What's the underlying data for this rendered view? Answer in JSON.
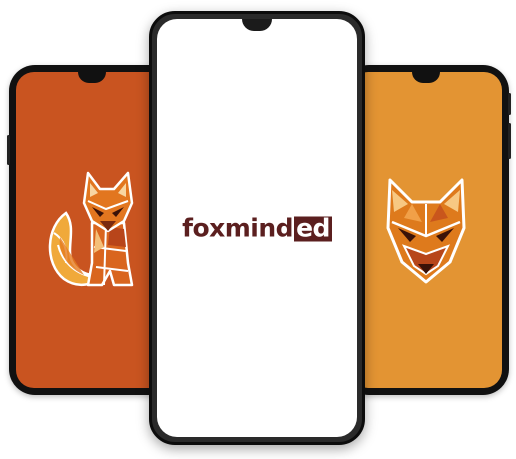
{
  "left_phone": {
    "screen_color": "#c95420",
    "icon": "fox-full-body-icon"
  },
  "center_phone": {
    "screen_color": "#ffffff",
    "logo_text_main": "foxmind",
    "logo_text_box": "ed",
    "brand_color": "#5b1f1f"
  },
  "right_phone": {
    "screen_color": "#e39433",
    "icon": "fox-head-icon"
  }
}
